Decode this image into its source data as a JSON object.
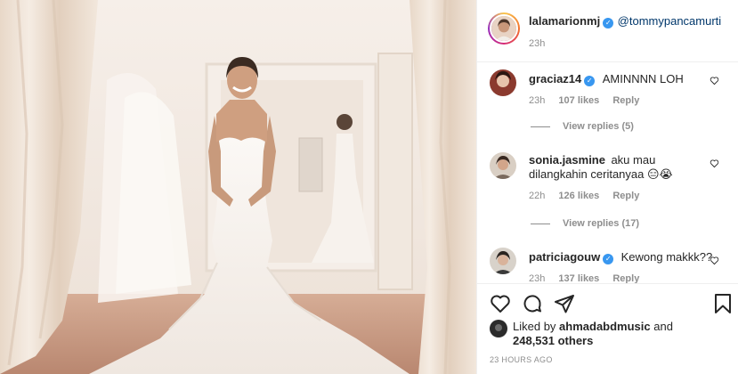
{
  "post": {
    "author": "lalamarionmj",
    "mention": "@tommypancamurti",
    "time": "23h",
    "image_icon": "wedding-dress-photo"
  },
  "comments": [
    {
      "user": "graciaz14",
      "verified": true,
      "text": "AMINNNN LOH",
      "time": "23h",
      "likes": "107 likes",
      "reply": "Reply",
      "view_replies": "View replies (5)"
    },
    {
      "user": "sonia.jasmine",
      "verified": false,
      "text_line1": "aku mau",
      "text_line2": "dilangkahin ceritanyaa 😑😭",
      "time": "22h",
      "likes": "126 likes",
      "reply": "Reply",
      "view_replies": "View replies (17)"
    },
    {
      "user": "patriciagouw",
      "verified": true,
      "text": "Kewong makkk??",
      "time": "23h",
      "likes": "137 likes",
      "reply": "Reply"
    }
  ],
  "actions": {
    "like_icon": "heart-icon",
    "comment_icon": "comment-icon",
    "share_icon": "share-icon",
    "save_icon": "bookmark-icon"
  },
  "liked_by": {
    "prefix": "Liked by",
    "user": "ahmadabdmusic",
    "and": "and",
    "count": "248,531 others"
  },
  "posted_ago": "23 HOURS AGO",
  "colors": {
    "verified": "#3897f0",
    "mention": "#00376b",
    "muted": "#8e8e8e",
    "text": "#262626"
  }
}
